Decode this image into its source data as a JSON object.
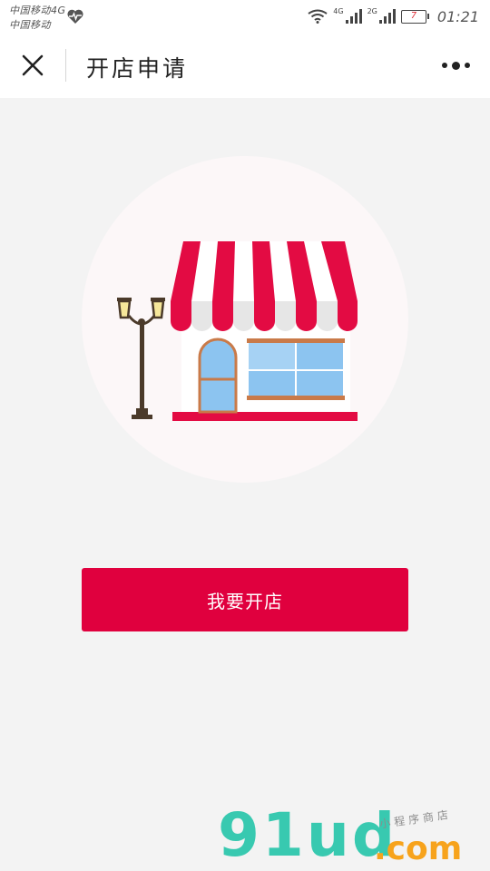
{
  "status_bar": {
    "carrier_1": "中国移动4G",
    "carrier_2": "中国移动",
    "net_1": "4G",
    "net_2": "2G",
    "battery": "7",
    "time": "01:21",
    "icons": [
      "heart-rate-icon",
      "wifi-icon",
      "signal-icon",
      "battery-icon"
    ]
  },
  "navbar": {
    "title": "开店申请",
    "close_icon": "close-icon",
    "more_icon": "more-dots-icon"
  },
  "illustration": {
    "subject": "storefront-with-awning-and-street-lamp",
    "colors": {
      "awning_red": "#e30b43",
      "awning_white": "#ffffff",
      "circle_bg": "#fcf7f8",
      "glass": "#8cc4f0",
      "frame": "#c97a49",
      "lamp": "#4b3a2a",
      "lamp_light": "#f6e79a"
    }
  },
  "main": {
    "open_shop_label": "我要开店"
  },
  "watermark": {
    "logo": "91ud",
    "domain": ".com",
    "tagline": "小程序商店"
  },
  "theme": {
    "accent": "#e0003e",
    "background": "#f3f3f3"
  }
}
